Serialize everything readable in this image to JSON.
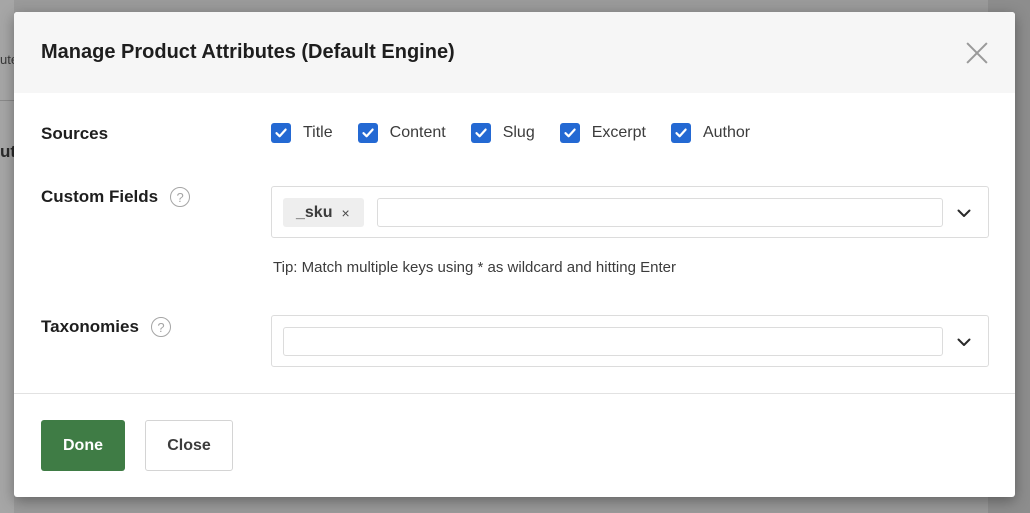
{
  "background": {
    "fragment_1": "ute",
    "fragment_2": "ute"
  },
  "modal": {
    "title": "Manage Product Attributes (Default Engine)",
    "close_icon": "close-icon"
  },
  "sources": {
    "label": "Sources",
    "options": [
      {
        "label": "Title",
        "checked": true
      },
      {
        "label": "Content",
        "checked": true
      },
      {
        "label": "Slug",
        "checked": true
      },
      {
        "label": "Excerpt",
        "checked": true
      },
      {
        "label": "Author",
        "checked": true
      }
    ]
  },
  "custom_fields": {
    "label": "Custom Fields",
    "help_glyph": "?",
    "tags": [
      {
        "text": "_sku",
        "remove": "×"
      }
    ],
    "input_value": "",
    "tip": "Tip: Match multiple keys using * as wildcard and hitting Enter"
  },
  "taxonomies": {
    "label": "Taxonomies",
    "help_glyph": "?",
    "input_value": ""
  },
  "footer": {
    "done_label": "Done",
    "close_label": "Close"
  },
  "colors": {
    "accent_checkbox": "#2469d3",
    "primary_button": "#3f7c45"
  }
}
